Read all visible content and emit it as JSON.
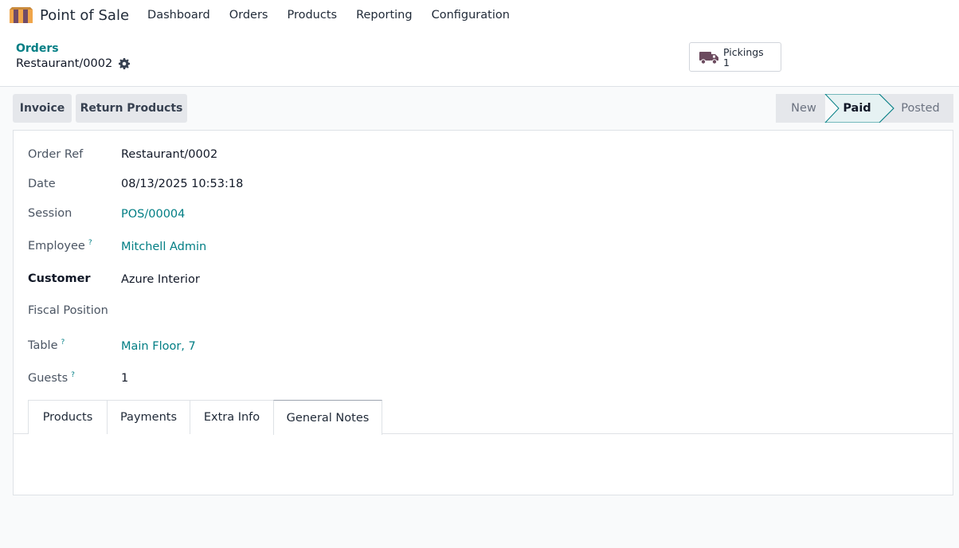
{
  "app": {
    "title": "Point of Sale",
    "nav": [
      "Dashboard",
      "Orders",
      "Products",
      "Reporting",
      "Configuration"
    ]
  },
  "breadcrumb": {
    "parent": "Orders",
    "current": "Restaurant/0002"
  },
  "smart_button": {
    "label": "Pickings",
    "value": "1"
  },
  "actions": {
    "invoice": "Invoice",
    "return_products": "Return Products"
  },
  "status": {
    "stages": [
      "New",
      "Paid",
      "Posted"
    ],
    "active": "Paid"
  },
  "fields": {
    "order_ref": {
      "label": "Order Ref",
      "value": "Restaurant/0002"
    },
    "date": {
      "label": "Date",
      "value": "08/13/2025 10:53:18"
    },
    "session": {
      "label": "Session",
      "value": "POS/00004"
    },
    "employee": {
      "label": "Employee",
      "value": "Mitchell Admin"
    },
    "customer": {
      "label": "Customer",
      "value": "Azure Interior"
    },
    "fiscal_position": {
      "label": "Fiscal Position",
      "value": ""
    },
    "table": {
      "label": "Table",
      "value": "Main Floor, 7"
    },
    "guests": {
      "label": "Guests",
      "value": "1"
    }
  },
  "help_mark": "?",
  "tabs": [
    "Products",
    "Payments",
    "Extra Info",
    "General Notes"
  ],
  "active_tab": "General Notes",
  "colors": {
    "accent": "#017e84",
    "logo_orange": "#f0a64a",
    "logo_purple": "#714b67",
    "truck": "#6b4a5e"
  },
  "icons": {
    "logo": "pos-logo-icon",
    "gear": "gear-icon",
    "truck": "truck-icon"
  }
}
